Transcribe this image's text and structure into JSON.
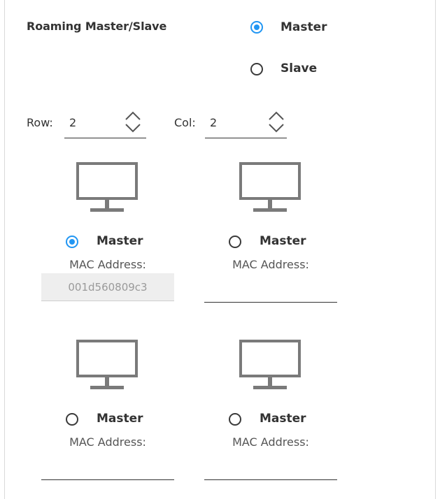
{
  "roaming": {
    "title": "Roaming Master/Slave",
    "options": [
      {
        "label": "Master",
        "checked": true
      },
      {
        "label": "Slave",
        "checked": false
      }
    ]
  },
  "grid": {
    "row_label": "Row:",
    "row_value": "2",
    "col_label": "Col:",
    "col_value": "2"
  },
  "displays": [
    {
      "master_label": "Master",
      "master_checked": true,
      "mac_label": "MAC Address:",
      "mac_value": "001d560809c3"
    },
    {
      "master_label": "Master",
      "master_checked": false,
      "mac_label": "MAC Address:",
      "mac_value": ""
    },
    {
      "master_label": "Master",
      "master_checked": false,
      "mac_label": "MAC Address:",
      "mac_value": ""
    },
    {
      "master_label": "Master",
      "master_checked": false,
      "mac_label": "MAC Address:",
      "mac_value": ""
    }
  ],
  "colors": {
    "accent": "#2196f3",
    "icon": "#7a7a7a"
  }
}
